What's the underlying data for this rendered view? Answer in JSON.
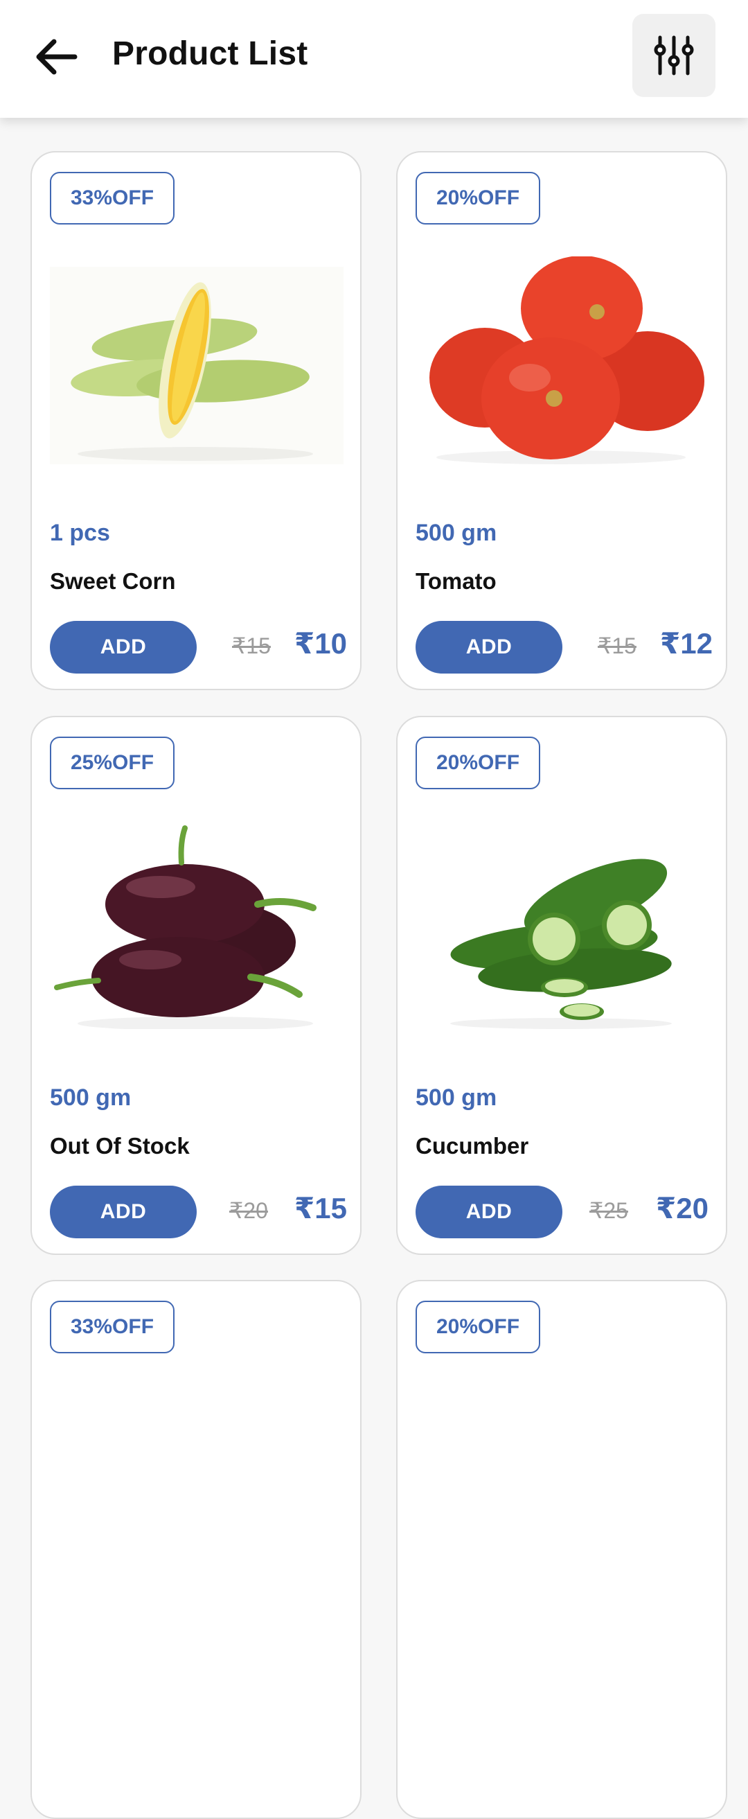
{
  "header": {
    "title": "Product List",
    "back_icon": "arrow-left-icon",
    "filter_icon": "sliders-icon"
  },
  "colors": {
    "accent": "#4168b3",
    "background": "#f7f7f7",
    "card_border": "#dcdcdc",
    "strike_price": "#9b9b9b"
  },
  "products": [
    {
      "discount": "33%OFF",
      "qty": "1 pcs",
      "name": "Sweet Corn",
      "add_label": "ADD",
      "old_price": "₹15",
      "new_price": "₹10",
      "image": "sweet-corn"
    },
    {
      "discount": "20%OFF",
      "qty": "500 gm",
      "name": "Tomato",
      "add_label": "ADD",
      "old_price": "₹15",
      "new_price": "₹12",
      "image": "tomato"
    },
    {
      "discount": "25%OFF",
      "qty": "500 gm",
      "name": "Out Of Stock",
      "add_label": "ADD",
      "old_price": "₹20",
      "new_price": "₹15",
      "image": "eggplant"
    },
    {
      "discount": "20%OFF",
      "qty": "500 gm",
      "name": "Cucumber",
      "add_label": "ADD",
      "old_price": "₹25",
      "new_price": "₹20",
      "image": "cucumber"
    },
    {
      "discount": "33%OFF"
    },
    {
      "discount": "20%OFF"
    }
  ]
}
